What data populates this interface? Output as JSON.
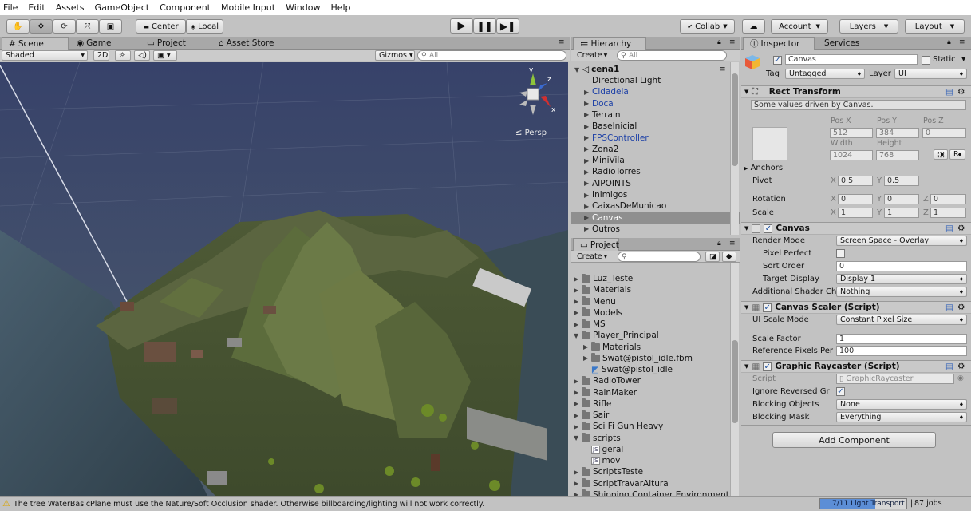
{
  "menu": [
    "File",
    "Edit",
    "Assets",
    "GameObject",
    "Component",
    "Mobile Input",
    "Window",
    "Help"
  ],
  "toolbar": {
    "pivot_label": "Center",
    "space_label": "Local",
    "collab_label": "Collab",
    "account_label": "Account",
    "layers_label": "Layers",
    "layout_label": "Layout"
  },
  "scene": {
    "tabs": [
      "Scene",
      "Game",
      "Project",
      "Asset Store"
    ],
    "shading": "Shaded",
    "mode_2d": "2D",
    "gizmos_label": "Gizmos",
    "search_placeholder": "All",
    "persp_label": "Persp",
    "gizmo_axes": {
      "y": "y",
      "x": "x",
      "z": "z"
    }
  },
  "hierarchy": {
    "tab": "Hierarchy",
    "create_label": "Create",
    "search_placeholder": "All",
    "scene_name": "cena1",
    "items": [
      {
        "label": "Directional Light",
        "arrow": false,
        "blue": false,
        "selected": false
      },
      {
        "label": "Cidadela",
        "arrow": true,
        "blue": true,
        "selected": false
      },
      {
        "label": "Doca",
        "arrow": true,
        "blue": true,
        "selected": false
      },
      {
        "label": "Terrain",
        "arrow": true,
        "blue": false,
        "selected": false
      },
      {
        "label": "BaseInicial",
        "arrow": true,
        "blue": false,
        "selected": false
      },
      {
        "label": "FPSController",
        "arrow": true,
        "blue": true,
        "selected": false
      },
      {
        "label": "Zona2",
        "arrow": true,
        "blue": false,
        "selected": false
      },
      {
        "label": "MiniVila",
        "arrow": true,
        "blue": false,
        "selected": false
      },
      {
        "label": "RadioTorres",
        "arrow": true,
        "blue": false,
        "selected": false
      },
      {
        "label": "AIPOINTS",
        "arrow": true,
        "blue": false,
        "selected": false
      },
      {
        "label": "Inimigos",
        "arrow": true,
        "blue": false,
        "selected": false
      },
      {
        "label": "CaixasDeMunicao",
        "arrow": true,
        "blue": false,
        "selected": false
      },
      {
        "label": "Canvas",
        "arrow": true,
        "blue": false,
        "selected": true
      },
      {
        "label": "Outros",
        "arrow": true,
        "blue": false,
        "selected": false
      }
    ]
  },
  "project": {
    "tab": "Project",
    "create_label": "Create",
    "items": [
      {
        "label": "Luz_Teste",
        "indent": 0,
        "type": "folder",
        "open": false
      },
      {
        "label": "Materials",
        "indent": 0,
        "type": "folder",
        "open": false
      },
      {
        "label": "Menu",
        "indent": 0,
        "type": "folder",
        "open": false
      },
      {
        "label": "Models",
        "indent": 0,
        "type": "folder",
        "open": false
      },
      {
        "label": "MS",
        "indent": 0,
        "type": "folder",
        "open": false
      },
      {
        "label": "Player_Principal",
        "indent": 0,
        "type": "folder",
        "open": true
      },
      {
        "label": "Materials",
        "indent": 1,
        "type": "folder",
        "open": false
      },
      {
        "label": "Swat@pistol_idle.fbm",
        "indent": 1,
        "type": "folder",
        "open": false
      },
      {
        "label": "Swat@pistol_idle",
        "indent": 1,
        "type": "model",
        "open": false
      },
      {
        "label": "RadioTower",
        "indent": 0,
        "type": "folder",
        "open": false
      },
      {
        "label": "RainMaker",
        "indent": 0,
        "type": "folder",
        "open": false
      },
      {
        "label": "Rifle",
        "indent": 0,
        "type": "folder",
        "open": false
      },
      {
        "label": "Sair",
        "indent": 0,
        "type": "folder",
        "open": false
      },
      {
        "label": "Sci Fi Gun Heavy",
        "indent": 0,
        "type": "folder",
        "open": false
      },
      {
        "label": "scripts",
        "indent": 0,
        "type": "folder",
        "open": true
      },
      {
        "label": "geral",
        "indent": 1,
        "type": "script",
        "open": false
      },
      {
        "label": "mov",
        "indent": 1,
        "type": "script",
        "open": false
      },
      {
        "label": "ScriptsTeste",
        "indent": 0,
        "type": "folder",
        "open": false
      },
      {
        "label": "ScriptTravarAltura",
        "indent": 0,
        "type": "folder",
        "open": false
      },
      {
        "label": "Shipping Container Environment",
        "indent": 0,
        "type": "folder",
        "open": false
      }
    ]
  },
  "inspector": {
    "tabs": [
      "Inspector",
      "Services"
    ],
    "object_name": "Canvas",
    "static_label": "Static",
    "tag_label": "Tag",
    "tag_value": "Untagged",
    "layer_label": "Layer",
    "layer_value": "UI",
    "rect": {
      "title": "Rect Transform",
      "note": "Some values driven by Canvas.",
      "posx_label": "Pos X",
      "posy_label": "Pos Y",
      "posz_label": "Pos Z",
      "posx": "512",
      "posy": "384",
      "posz": "0",
      "width_label": "Width",
      "height_label": "Height",
      "width": "1024",
      "height": "768",
      "anchors_label": "Anchors",
      "pivot_label": "Pivot",
      "pivot_x": "0.5",
      "pivot_y": "0.5",
      "rotation_label": "Rotation",
      "rot_x": "0",
      "rot_y": "0",
      "rot_z": "0",
      "scale_label": "Scale",
      "scale_x": "1",
      "scale_y": "1",
      "scale_z": "1",
      "x": "X",
      "y": "Y",
      "z": "Z",
      "r_button": "R"
    },
    "canvas": {
      "title": "Canvas",
      "render_mode_label": "Render Mode",
      "render_mode": "Screen Space - Overlay",
      "pixel_perfect_label": "Pixel Perfect",
      "sort_order_label": "Sort Order",
      "sort_order": "0",
      "target_display_label": "Target Display",
      "target_display": "Display 1",
      "additional_label": "Additional Shader Ch",
      "additional_value": "Nothing"
    },
    "scaler": {
      "title": "Canvas Scaler (Script)",
      "ui_scale_label": "UI Scale Mode",
      "ui_scale": "Constant Pixel Size",
      "scale_factor_label": "Scale Factor",
      "scale_factor": "1",
      "ref_pixels_label": "Reference Pixels Per",
      "ref_pixels": "100"
    },
    "raycaster": {
      "title": "Graphic Raycaster (Script)",
      "script_label": "Script",
      "script_value": "GraphicRaycaster",
      "ignore_label": "Ignore Reversed Gr",
      "blocking_objects_label": "Blocking Objects",
      "blocking_objects": "None",
      "blocking_mask_label": "Blocking Mask",
      "blocking_mask": "Everything"
    },
    "add_component": "Add Component"
  },
  "status": {
    "message": "The tree WaterBasicPlane must use the Nature/Soft Occlusion shader. Otherwise billboarding/lighting will not work correctly.",
    "progress_label": "7/11 Light Transport",
    "jobs": "87 jobs",
    "progress_fraction": 0.64
  },
  "colors": {
    "selection": "#3d6eb5",
    "link_blue": "#1b3fa6",
    "background": "#c2c2c2"
  }
}
